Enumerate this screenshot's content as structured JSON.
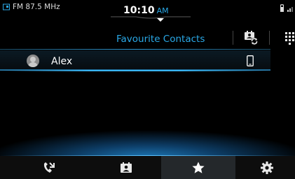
{
  "status_bar": {
    "radio_source": "FM 87.5 MHz",
    "time": "10:10",
    "ampm": "AM",
    "icons": [
      "radio-icon",
      "battery-icon",
      "signal-icon"
    ]
  },
  "header": {
    "title": "Favourite Contacts",
    "actions": [
      "sync-contacts-icon",
      "dialpad-icon"
    ]
  },
  "favourites": [
    {
      "name": "Alex",
      "phone_type": "mobile-icon"
    }
  ],
  "tabs": [
    {
      "icon": "recent-calls-icon",
      "selected": false
    },
    {
      "icon": "contacts-icon",
      "selected": false
    },
    {
      "icon": "star-icon",
      "selected": true
    },
    {
      "icon": "settings-icon",
      "selected": false
    }
  ],
  "colors": {
    "accent": "#2aa8e6",
    "background": "#000000",
    "selected_tab": "#24282b"
  }
}
